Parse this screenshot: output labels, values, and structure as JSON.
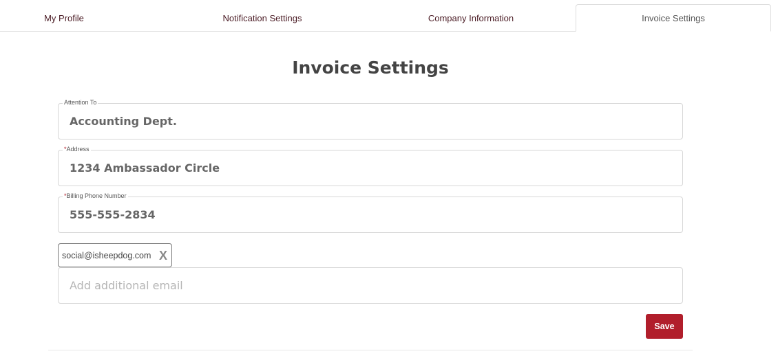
{
  "tabs": [
    {
      "label": "My Profile"
    },
    {
      "label": "Notification Settings"
    },
    {
      "label": "Company Information"
    },
    {
      "label": "Invoice Settings"
    }
  ],
  "page": {
    "title": "Invoice Settings"
  },
  "form": {
    "attention_to": {
      "label": "Attention To",
      "value": "Accounting Dept."
    },
    "address": {
      "required_mark": "*",
      "label": "Address",
      "value": "1234 Ambassador Circle"
    },
    "billing_phone": {
      "required_mark": "*",
      "label": "Billing Phone Number",
      "value": "555-555-2834"
    },
    "email_chip": {
      "value": "social@isheepdog.com",
      "remove_glyph": "X"
    },
    "additional_email": {
      "placeholder": "Add additional email",
      "value": ""
    },
    "save_label": "Save"
  },
  "colors": {
    "accent": "#b11e2b",
    "tab_text": "#4a1b24"
  }
}
